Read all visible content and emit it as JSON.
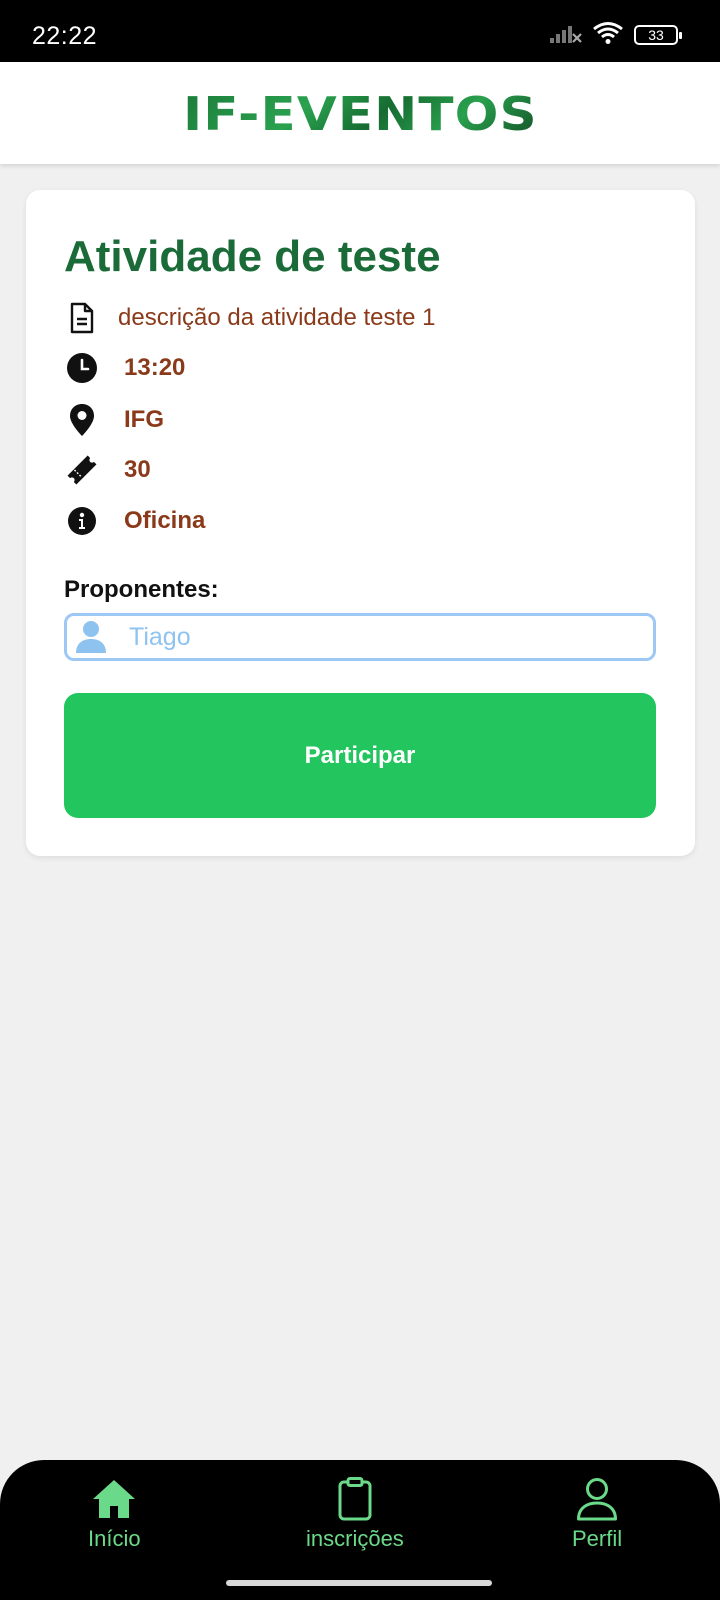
{
  "status_bar": {
    "time": "22:22",
    "battery": "33",
    "icons": [
      "signal-off-icon",
      "wifi-icon",
      "battery-icon"
    ]
  },
  "header": {
    "logo_text": "IF-EVENTOS"
  },
  "activity": {
    "title": "Atividade de teste",
    "description": "descrição da atividade teste 1",
    "time": "13:20",
    "location": "IFG",
    "vacancies": "30",
    "type": "Oficina",
    "proponents_label": "Proponentes:",
    "proponents": [
      "Tiago"
    ],
    "participate_label": "Participar"
  },
  "bottom_nav": {
    "items": [
      {
        "label": "Início",
        "icon": "home-icon"
      },
      {
        "label": "inscrições",
        "icon": "clipboard-icon"
      },
      {
        "label": "Perfil",
        "icon": "user-icon"
      }
    ]
  },
  "colors": {
    "title": "#1b6b38",
    "info_text": "#8a3a1a",
    "button": "#23c55e",
    "nav_accent": "#6bd98a",
    "field_border": "#9ec8f4"
  }
}
